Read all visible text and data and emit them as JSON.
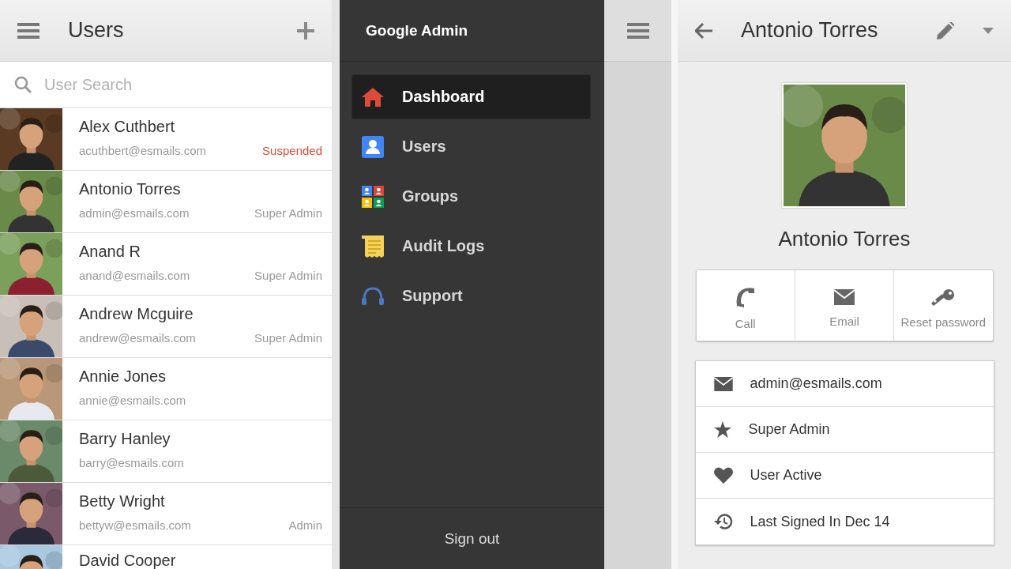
{
  "users_screen": {
    "title": "Users",
    "search": {
      "placeholder": "User Search"
    },
    "users": [
      {
        "name": "Alex Cuthbert",
        "email": "acuthbert@esmails.com",
        "status": "Suspended",
        "color": "#dd4b39"
      },
      {
        "name": "Antonio Torres",
        "email": "admin@esmails.com",
        "status": "Super Admin",
        "color": "#999999"
      },
      {
        "name": "Anand R",
        "email": "anand@esmails.com",
        "status": "Super Admin",
        "color": "#999999"
      },
      {
        "name": "Andrew Mcguire",
        "email": "andrew@esmails.com",
        "status": "Super Admin",
        "color": "#999999"
      },
      {
        "name": "Annie Jones",
        "email": "annie@esmails.com"
      },
      {
        "name": "Barry Hanley",
        "email": "barry@esmails.com"
      },
      {
        "name": "Betty Wright",
        "email": "bettyw@esmails.com",
        "status": "Admin",
        "color": "#999999"
      },
      {
        "name": "David Cooper"
      }
    ]
  },
  "drawer": {
    "title": "Google Admin",
    "items": [
      {
        "label": "Dashboard",
        "selected": true
      },
      {
        "label": "Users",
        "selected": false
      },
      {
        "label": "Groups",
        "selected": false
      },
      {
        "label": "Audit Logs",
        "selected": false
      },
      {
        "label": "Support",
        "selected": false
      }
    ],
    "sign_out": "Sign out"
  },
  "profile": {
    "title": "Antonio Torres",
    "name": "Antonio Torres",
    "actions": [
      "Call",
      "Email",
      "Reset password"
    ],
    "details": [
      "admin@esmails.com",
      "Super Admin",
      "User Active",
      "Last Signed In Dec 14"
    ]
  }
}
